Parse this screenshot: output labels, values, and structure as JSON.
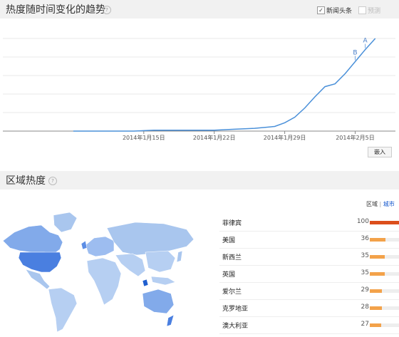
{
  "trend": {
    "title": "热度随时间变化的趋势",
    "help": "?",
    "headlines_label": "新闻头条",
    "forecast_label": "预测",
    "embed_label": "嵌入"
  },
  "chart_data": {
    "type": "line",
    "x": [
      "2014-01-08",
      "2014-01-10",
      "2014-01-12",
      "2014-01-14",
      "2014-01-16",
      "2014-01-18",
      "2014-01-20",
      "2014-01-22",
      "2014-01-24",
      "2014-01-26",
      "2014-01-28",
      "2014-01-29",
      "2014-01-30",
      "2014-01-31",
      "2014-02-01",
      "2014-02-02",
      "2014-02-03",
      "2014-02-04",
      "2014-02-05",
      "2014-02-06",
      "2014-02-07"
    ],
    "values": [
      0,
      0,
      0,
      0,
      1,
      1,
      1,
      1,
      2,
      3,
      5,
      9,
      15,
      25,
      37,
      48,
      51,
      62,
      75,
      88,
      100
    ],
    "x_tick_labels": [
      "2014年1月15日",
      "2014年1月22日",
      "2014年1月29日",
      "2014年2月5日"
    ],
    "x_tick_dates": [
      "2014-01-15",
      "2014-01-22",
      "2014-01-29",
      "2014-02-05"
    ],
    "annotations": [
      {
        "label": "A",
        "x": "2014-02-06"
      },
      {
        "label": "B",
        "x": "2014-02-05"
      }
    ],
    "ylim": [
      0,
      100
    ],
    "line_color": "#4a90d9",
    "grid": true
  },
  "region": {
    "title": "区域热度",
    "help": "?",
    "tab_region": "区域",
    "tab_city": "城市",
    "rows": [
      {
        "name": "菲律宾",
        "value": "100",
        "bar": 1.0,
        "color": "#dc4e1b"
      },
      {
        "name": "美国",
        "value": "36",
        "bar": 0.36,
        "color": "#f3a24a"
      },
      {
        "name": "新西兰",
        "value": "35",
        "bar": 0.35,
        "color": "#f3a24a"
      },
      {
        "name": "英国",
        "value": "35",
        "bar": 0.35,
        "color": "#f3a24a"
      },
      {
        "name": "爱尔兰",
        "value": "29",
        "bar": 0.29,
        "color": "#f3a24a"
      },
      {
        "name": "克罗地亚",
        "value": "28",
        "bar": 0.28,
        "color": "#f3a24a"
      },
      {
        "name": "澳大利亚",
        "value": "27",
        "bar": 0.27,
        "color": "#f3a24a"
      }
    ]
  }
}
